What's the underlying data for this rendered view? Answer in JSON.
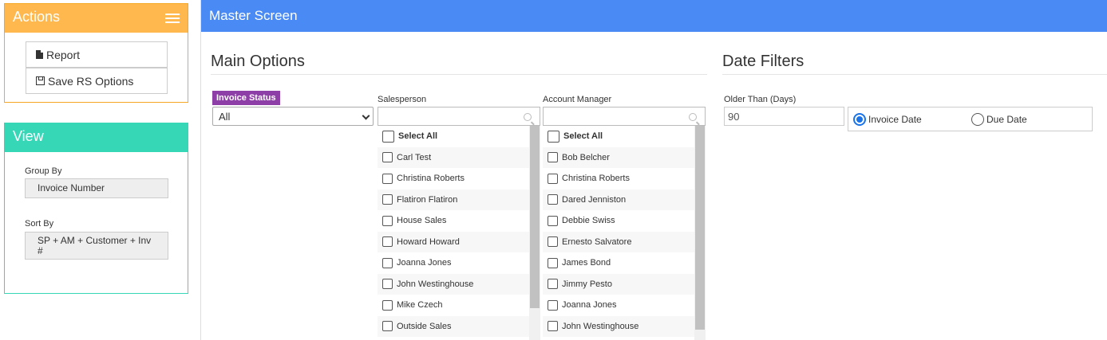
{
  "actions": {
    "title": "Actions",
    "report_label": "Report",
    "save_label": "Save RS Options"
  },
  "view": {
    "title": "View",
    "group_by_label": "Group By",
    "group_by_value": "Invoice Number",
    "sort_by_label": "Sort By",
    "sort_by_value_line1": "SP + AM + Customer + Inv",
    "sort_by_value_line2": "#"
  },
  "main": {
    "header": "Master Screen",
    "main_options_title": "Main Options",
    "date_filters_title": "Date Filters"
  },
  "invoice_status": {
    "label": "Invoice Status",
    "selected": "All"
  },
  "salesperson": {
    "label": "Salesperson",
    "select_all": "Select All",
    "items": [
      "Carl Test",
      "Christina Roberts",
      "Flatiron Flatiron",
      "House Sales",
      "Howard Howard",
      "Joanna Jones",
      "John Westinghouse",
      "Mike Czech",
      "Outside Sales"
    ],
    "scroll_fraction_visible": 0.85
  },
  "account_manager": {
    "label": "Account Manager",
    "select_all": "Select All",
    "items": [
      "Bob Belcher",
      "Christina Roberts",
      "Dared Jenniston",
      "Debbie Swiss",
      "Ernesto Salvatore",
      "James Bond",
      "Jimmy Pesto",
      "Joanna Jones",
      "John Westinghouse"
    ],
    "scroll_fraction_visible": 0.95
  },
  "date_filters": {
    "older_than_label": "Older Than (Days)",
    "older_than_value": "90",
    "radio_invoice_date": "Invoice Date",
    "radio_due_date": "Due Date",
    "selected_radio": "Invoice Date"
  },
  "colors": {
    "actions_accent": "#ffb84d",
    "view_accent": "#36d7b7",
    "header_blue": "#4a8af4",
    "invoice_status_purple": "#8e3ea7"
  }
}
